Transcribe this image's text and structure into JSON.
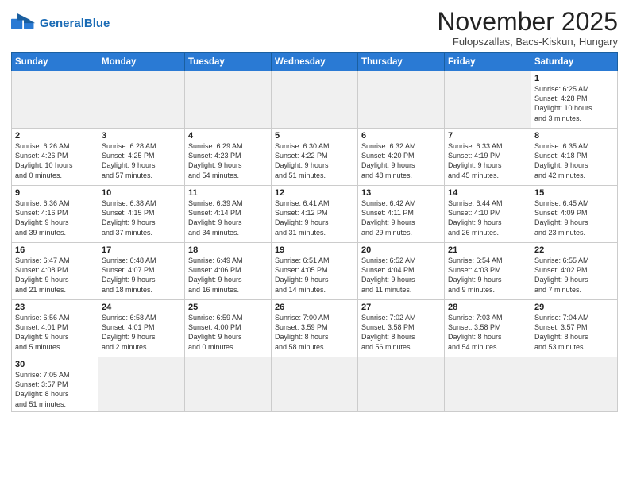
{
  "header": {
    "logo_general": "General",
    "logo_blue": "Blue",
    "month_title": "November 2025",
    "location": "Fulopszallas, Bacs-Kiskun, Hungary"
  },
  "weekdays": [
    "Sunday",
    "Monday",
    "Tuesday",
    "Wednesday",
    "Thursday",
    "Friday",
    "Saturday"
  ],
  "weeks": [
    [
      {
        "day": "",
        "info": "",
        "empty": true
      },
      {
        "day": "",
        "info": "",
        "empty": true
      },
      {
        "day": "",
        "info": "",
        "empty": true
      },
      {
        "day": "",
        "info": "",
        "empty": true
      },
      {
        "day": "",
        "info": "",
        "empty": true
      },
      {
        "day": "",
        "info": "",
        "empty": true
      },
      {
        "day": "1",
        "info": "Sunrise: 6:25 AM\nSunset: 4:28 PM\nDaylight: 10 hours\nand 3 minutes.",
        "empty": false
      }
    ],
    [
      {
        "day": "2",
        "info": "Sunrise: 6:26 AM\nSunset: 4:26 PM\nDaylight: 10 hours\nand 0 minutes.",
        "empty": false
      },
      {
        "day": "3",
        "info": "Sunrise: 6:28 AM\nSunset: 4:25 PM\nDaylight: 9 hours\nand 57 minutes.",
        "empty": false
      },
      {
        "day": "4",
        "info": "Sunrise: 6:29 AM\nSunset: 4:23 PM\nDaylight: 9 hours\nand 54 minutes.",
        "empty": false
      },
      {
        "day": "5",
        "info": "Sunrise: 6:30 AM\nSunset: 4:22 PM\nDaylight: 9 hours\nand 51 minutes.",
        "empty": false
      },
      {
        "day": "6",
        "info": "Sunrise: 6:32 AM\nSunset: 4:20 PM\nDaylight: 9 hours\nand 48 minutes.",
        "empty": false
      },
      {
        "day": "7",
        "info": "Sunrise: 6:33 AM\nSunset: 4:19 PM\nDaylight: 9 hours\nand 45 minutes.",
        "empty": false
      },
      {
        "day": "8",
        "info": "Sunrise: 6:35 AM\nSunset: 4:18 PM\nDaylight: 9 hours\nand 42 minutes.",
        "empty": false
      }
    ],
    [
      {
        "day": "9",
        "info": "Sunrise: 6:36 AM\nSunset: 4:16 PM\nDaylight: 9 hours\nand 39 minutes.",
        "empty": false
      },
      {
        "day": "10",
        "info": "Sunrise: 6:38 AM\nSunset: 4:15 PM\nDaylight: 9 hours\nand 37 minutes.",
        "empty": false
      },
      {
        "day": "11",
        "info": "Sunrise: 6:39 AM\nSunset: 4:14 PM\nDaylight: 9 hours\nand 34 minutes.",
        "empty": false
      },
      {
        "day": "12",
        "info": "Sunrise: 6:41 AM\nSunset: 4:12 PM\nDaylight: 9 hours\nand 31 minutes.",
        "empty": false
      },
      {
        "day": "13",
        "info": "Sunrise: 6:42 AM\nSunset: 4:11 PM\nDaylight: 9 hours\nand 29 minutes.",
        "empty": false
      },
      {
        "day": "14",
        "info": "Sunrise: 6:44 AM\nSunset: 4:10 PM\nDaylight: 9 hours\nand 26 minutes.",
        "empty": false
      },
      {
        "day": "15",
        "info": "Sunrise: 6:45 AM\nSunset: 4:09 PM\nDaylight: 9 hours\nand 23 minutes.",
        "empty": false
      }
    ],
    [
      {
        "day": "16",
        "info": "Sunrise: 6:47 AM\nSunset: 4:08 PM\nDaylight: 9 hours\nand 21 minutes.",
        "empty": false
      },
      {
        "day": "17",
        "info": "Sunrise: 6:48 AM\nSunset: 4:07 PM\nDaylight: 9 hours\nand 18 minutes.",
        "empty": false
      },
      {
        "day": "18",
        "info": "Sunrise: 6:49 AM\nSunset: 4:06 PM\nDaylight: 9 hours\nand 16 minutes.",
        "empty": false
      },
      {
        "day": "19",
        "info": "Sunrise: 6:51 AM\nSunset: 4:05 PM\nDaylight: 9 hours\nand 14 minutes.",
        "empty": false
      },
      {
        "day": "20",
        "info": "Sunrise: 6:52 AM\nSunset: 4:04 PM\nDaylight: 9 hours\nand 11 minutes.",
        "empty": false
      },
      {
        "day": "21",
        "info": "Sunrise: 6:54 AM\nSunset: 4:03 PM\nDaylight: 9 hours\nand 9 minutes.",
        "empty": false
      },
      {
        "day": "22",
        "info": "Sunrise: 6:55 AM\nSunset: 4:02 PM\nDaylight: 9 hours\nand 7 minutes.",
        "empty": false
      }
    ],
    [
      {
        "day": "23",
        "info": "Sunrise: 6:56 AM\nSunset: 4:01 PM\nDaylight: 9 hours\nand 5 minutes.",
        "empty": false
      },
      {
        "day": "24",
        "info": "Sunrise: 6:58 AM\nSunset: 4:01 PM\nDaylight: 9 hours\nand 2 minutes.",
        "empty": false
      },
      {
        "day": "25",
        "info": "Sunrise: 6:59 AM\nSunset: 4:00 PM\nDaylight: 9 hours\nand 0 minutes.",
        "empty": false
      },
      {
        "day": "26",
        "info": "Sunrise: 7:00 AM\nSunset: 3:59 PM\nDaylight: 8 hours\nand 58 minutes.",
        "empty": false
      },
      {
        "day": "27",
        "info": "Sunrise: 7:02 AM\nSunset: 3:58 PM\nDaylight: 8 hours\nand 56 minutes.",
        "empty": false
      },
      {
        "day": "28",
        "info": "Sunrise: 7:03 AM\nSunset: 3:58 PM\nDaylight: 8 hours\nand 54 minutes.",
        "empty": false
      },
      {
        "day": "29",
        "info": "Sunrise: 7:04 AM\nSunset: 3:57 PM\nDaylight: 8 hours\nand 53 minutes.",
        "empty": false
      }
    ],
    [
      {
        "day": "30",
        "info": "Sunrise: 7:05 AM\nSunset: 3:57 PM\nDaylight: 8 hours\nand 51 minutes.",
        "empty": false
      },
      {
        "day": "",
        "info": "",
        "empty": true
      },
      {
        "day": "",
        "info": "",
        "empty": true
      },
      {
        "day": "",
        "info": "",
        "empty": true
      },
      {
        "day": "",
        "info": "",
        "empty": true
      },
      {
        "day": "",
        "info": "",
        "empty": true
      },
      {
        "day": "",
        "info": "",
        "empty": true
      }
    ]
  ]
}
